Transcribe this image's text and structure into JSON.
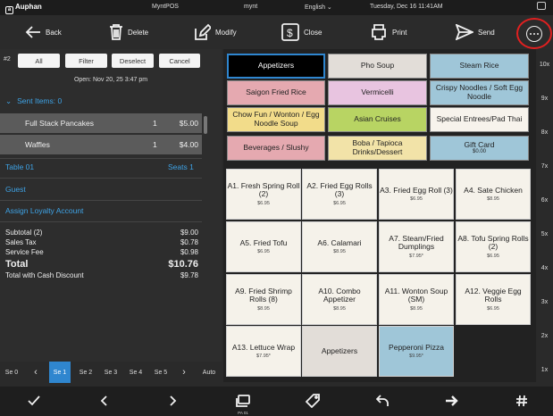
{
  "statusbar": {
    "brand": "Auphan",
    "app": "MyntPOS",
    "user": "mynt",
    "language": "English",
    "datetime": "Tuesday, Dec 16 11:41AM"
  },
  "toolbar": {
    "back": "Back",
    "delete": "Delete",
    "modify": "Modify",
    "close": "Close",
    "print": "Print",
    "send": "Send"
  },
  "order": {
    "seat_num": "#2",
    "buttons": [
      "All",
      "Filter",
      "Deselect",
      "Cancel"
    ],
    "opened": "Open: Nov 20, 25 3:47 pm",
    "sent_items": "Sent Items: 0",
    "items": [
      {
        "name": "Full Stack Pancakes",
        "qty": "1",
        "price": "$5.00"
      },
      {
        "name": "Waffles",
        "qty": "1",
        "price": "$4.00"
      }
    ],
    "table": "Table 01",
    "seats": "Seats 1",
    "guest": "Guest",
    "loyalty": "Assign Loyalty Account",
    "totals": [
      {
        "label": "Subtotal (2)",
        "value": "$9.00"
      },
      {
        "label": "Sales Tax",
        "value": "$0.78"
      },
      {
        "label": "Service Fee",
        "value": "$0.98"
      }
    ],
    "total_label": "Total",
    "total_value": "$10.76",
    "cash_label": "Total with Cash Discount",
    "cash_value": "$9.78"
  },
  "seats": {
    "items": [
      "Se 0",
      "Se 1",
      "Se 2",
      "Se 3",
      "Se 4",
      "Se 5"
    ],
    "active": "Se 1",
    "auto": "Auto"
  },
  "categories": [
    {
      "label": "Appetizers",
      "color": "#000000"
    },
    {
      "label": "Pho Soup",
      "color": "#e2ddd8"
    },
    {
      "label": "Steam Rice",
      "color": "#9fc6d8"
    },
    {
      "label": "Saigon Fried Rice",
      "color": "#e5a9b0"
    },
    {
      "label": "Vermicelli",
      "color": "#e8c4e0"
    },
    {
      "label": "Crispy Noodles / Soft Egg Noodle",
      "color": "#9fc6d8"
    },
    {
      "label": "Chow Fun / Wonton / Egg Noodle Soup",
      "color": "#f2dc8a"
    },
    {
      "label": "Asian Cruises",
      "color": "#b8d463"
    },
    {
      "label": "Special Entrees/Pad Thai",
      "color": "#f7f3ec"
    },
    {
      "label": "Beverages / Slushy",
      "color": "#e5a9b0"
    },
    {
      "label": "Boba / Tapioca Drinks/Dessert",
      "color": "#f2e3a8"
    },
    {
      "label": "Gift Card",
      "color": "#9fc6d8",
      "sub": "$0.00"
    }
  ],
  "menu_items": [
    {
      "label": "A1. Fresh Spring Roll (2)",
      "price": "$6.95"
    },
    {
      "label": "A2. Fried Egg Rolls (3)",
      "price": "$6.95"
    },
    {
      "label": "A3. Fried Egg Roll (3)",
      "price": "$6.95"
    },
    {
      "label": "A4. Sate Chicken",
      "price": "$8.95"
    },
    {
      "label": "A5. Fried Tofu",
      "price": "$6.95"
    },
    {
      "label": "A6. Calamari",
      "price": "$8.95"
    },
    {
      "label": "A7. Steam/Fried Dumplings",
      "price": "$7.95*"
    },
    {
      "label": "A8. Tofu Spring Rolls (2)",
      "price": "$6.95"
    },
    {
      "label": "A9. Fried Shrimp Rolls (8)",
      "price": "$8.95"
    },
    {
      "label": "A10. Combo Appetizer",
      "price": "$8.95"
    },
    {
      "label": "A11. Wonton Soup (SM)",
      "price": "$8.95"
    },
    {
      "label": "A12. Veggie Egg Rolls",
      "price": "$6.95"
    },
    {
      "label": "A13. Lettuce Wrap",
      "price": "$7.95*"
    },
    {
      "label": "Appetizers",
      "price": "",
      "color": "#e2ddd8"
    },
    {
      "label": "Pepperoni Pizza",
      "price": "$9.95*",
      "color": "#9fc6d8"
    }
  ],
  "zoom": [
    "10x",
    "9x",
    "8x",
    "7x",
    "6x",
    "5x",
    "4x",
    "3x",
    "2x",
    "1x"
  ],
  "bottom": {
    "sub_label": "PA 01"
  },
  "colors": {
    "accent": "#3ea3e6",
    "active_seat": "#2f86cf",
    "highlight_ring": "#e02020"
  }
}
